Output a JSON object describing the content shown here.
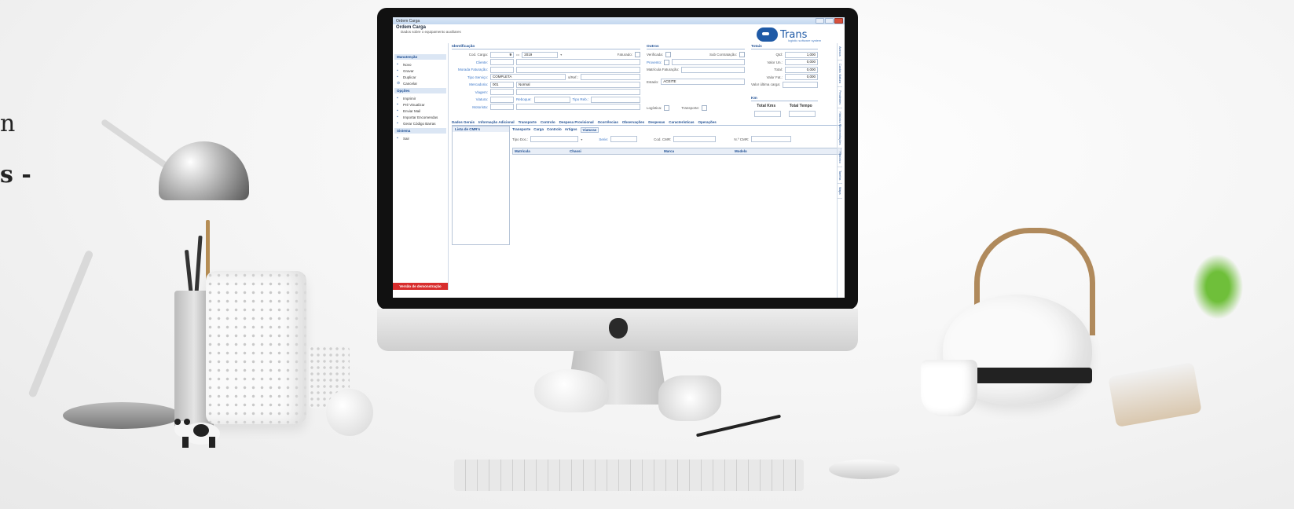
{
  "side_text": {
    "line1": "n",
    "line2": "s -"
  },
  "window": {
    "title": "Ordem Carga"
  },
  "header": {
    "title": "Ordem Carga",
    "subtitle": "Dados sobre o equipamento auxiliares"
  },
  "logo": {
    "word": "Trans",
    "tagline": "logistic software system"
  },
  "nav": {
    "manutencao": "Manutenção",
    "items_manut": [
      "Novo",
      "Gravar",
      "Duplicar",
      "Cancelar"
    ],
    "opcoes": "Opções",
    "items_opcoes": [
      "Imprimir",
      "Pré Visualizar",
      "Enviar Mail",
      "Importar Encomendas",
      "Gerar Código Barras"
    ],
    "sistema": "Sistema",
    "items_sistema": [
      "Sair"
    ],
    "demo": "Versão de demonstração"
  },
  "identificacao": {
    "title": "Identificação",
    "cod_carga_label": "Cod. Carga:",
    "cod_carga": "9",
    "ano": "2019",
    "faturado_label": "Faturado:",
    "cliente_label": "Cliente:",
    "morada_label": "Morada Faturação:",
    "tipo_servico_label": "Tipo Serviço:",
    "tipo_servico": "COMPLETA",
    "ref_label": "s/Ref.:",
    "mercadoria_label": "Mercadoria:",
    "mercadoria_code": "001",
    "mercadoria": "Normal",
    "viagem_label": "Viagem:",
    "viatura_label": "Viatura:",
    "reboque_label": "Reboque:",
    "tipo_reb_label": "Tipo Reb.:",
    "motorista_label": "Motorista:"
  },
  "outros": {
    "title": "Outros",
    "verificada_label": "Verificada:",
    "sub_contratacao_label": "Sub Contratação:",
    "provento_label": "Provento:",
    "matricula_label": "Matrícula Faturação:",
    "estado_label": "Estado:",
    "estado": "ACEITE",
    "logistica_label": "Logística:",
    "transporte_label": "Transporte:"
  },
  "totais": {
    "title": "Totais",
    "qtd_label": "Qtd:",
    "qtd": "1,000",
    "valor_un_label": "Valor Un.:",
    "valor_un": "0,000",
    "total_label": "Total:",
    "total": "0,000",
    "valor_fat_label": "Valor Fat.:",
    "valor_fat": "0,000",
    "valor_ultima_label": "Valor última carga:"
  },
  "km": {
    "title": "Km",
    "total_kms": "Total Kms",
    "total_tempo": "Total Tempo"
  },
  "tabs": [
    "Dados Gerais",
    "Informação Adicional",
    "Transporte",
    "Controlo",
    "Despesa Provisional",
    "Ocorrências",
    "Observações",
    "Despesas",
    "Características",
    "Operações"
  ],
  "lista_cmr": "Lista de CMR's",
  "subtabs": [
    "Transporte",
    "Carga",
    "Controlo",
    "Artigos",
    "Viaturas"
  ],
  "cmr_form": {
    "tipo_doc_label": "Tipo Doc.:",
    "serie_label": "Serie:",
    "cod_cmr_label": "Cod. CMR:",
    "n_cmr_label": "N.º CMR:"
  },
  "grid_columns": [
    "Matrícula",
    "Chassi",
    "Marca",
    "Modelo"
  ],
  "vtabs": [
    "Anexos",
    "Custos Viatura",
    "Pendentes",
    "Histórico Movimentações",
    "Histórico",
    "Tarefas",
    "Mapa"
  ]
}
